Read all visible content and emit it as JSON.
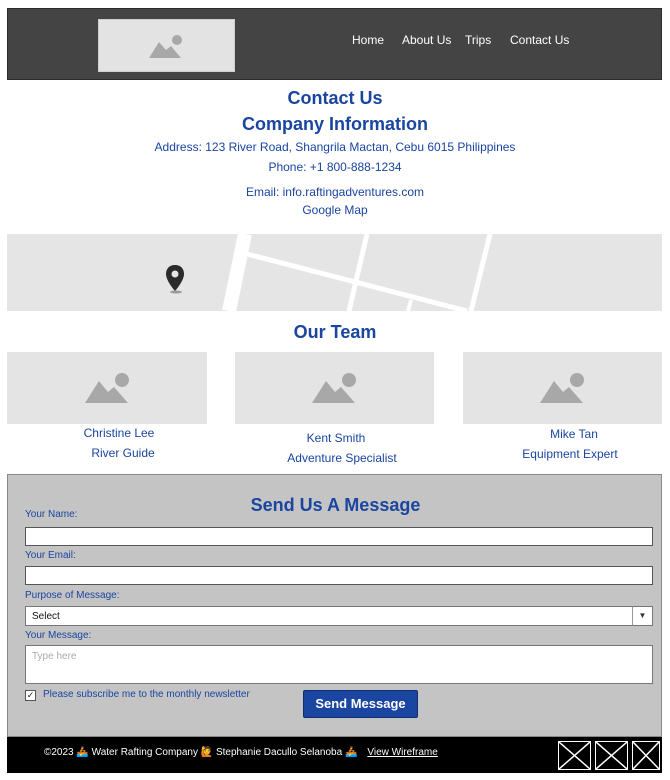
{
  "header": {
    "logo_alt": "logo placeholder",
    "nav": [
      {
        "label": "Home"
      },
      {
        "label": "About Us"
      },
      {
        "label": "Trips"
      },
      {
        "label": "Contact Us"
      }
    ]
  },
  "contact": {
    "title": "Contact Us",
    "subtitle": "Company Information",
    "address": "Address: 123 River Road, Shangrila Mactan, Cebu 6015 Philippines",
    "phone": "Phone: +1 800-888-1234",
    "email": "Email: info.raftingadventures.com",
    "map_link": "Google Map"
  },
  "team": {
    "title": "Our Team",
    "members": [
      {
        "name": "Christine Lee",
        "role": "River Guide"
      },
      {
        "name": "Kent Smith",
        "role": "Adventure Specialist"
      },
      {
        "name": "Mike Tan",
        "role": "Equipment Expert"
      }
    ]
  },
  "form": {
    "title": "Send Us A Message",
    "name_label": "Your Name:",
    "email_label": "Your Email:",
    "purpose_label": "Purpose of Message:",
    "purpose_selected": "Select",
    "message_label": "Your Message:",
    "message_placeholder": "Type here",
    "newsletter_label": "Please subscribe me to the monthly newsletter",
    "newsletter_checked": true,
    "submit_label": "Send Message"
  },
  "footer": {
    "text": "©2023 🚣 Water Rafting Company 🙋 Stephanie Dacullo Selanoba 🚣",
    "link": "View Wireframe",
    "social_icons": [
      "social-placeholder-icon",
      "social-placeholder-icon",
      "social-placeholder-icon"
    ]
  },
  "colors": {
    "header_bg": "#444444",
    "accent": "#1a45a0",
    "form_bg": "#c4c4c4",
    "footer_bg": "#000000"
  }
}
